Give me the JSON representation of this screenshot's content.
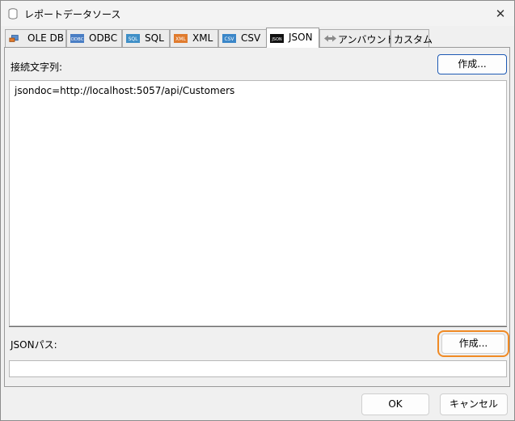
{
  "window": {
    "title": "レポートデータソース",
    "close_glyph": "✕"
  },
  "tabs": [
    {
      "label": "OLE DB",
      "icon": "ole-db-icon"
    },
    {
      "label": "ODBC",
      "icon": "odbc-icon",
      "badge": "ODBC"
    },
    {
      "label": "SQL",
      "icon": "sql-icon",
      "badge": "SQL"
    },
    {
      "label": "XML",
      "icon": "xml-icon",
      "badge": "XML"
    },
    {
      "label": "CSV",
      "icon": "csv-icon",
      "badge": "CSV"
    },
    {
      "label": "JSON",
      "icon": "json-icon",
      "badge": "JSON",
      "active": true
    },
    {
      "label": "アンバウンド",
      "icon": "unbound-icon"
    },
    {
      "label": "カスタム"
    }
  ],
  "connection": {
    "label": "接続文字列:",
    "build_button": "作成...",
    "value": "jsondoc=http://localhost:5057/api/Customers"
  },
  "json_path": {
    "label": "JSONパス:",
    "build_button": "作成...",
    "value": ""
  },
  "footer": {
    "ok_label": "OK",
    "cancel_label": "キャンセル"
  },
  "colors": {
    "highlight": "#f08a24",
    "focus_border": "#1e5ab4"
  }
}
